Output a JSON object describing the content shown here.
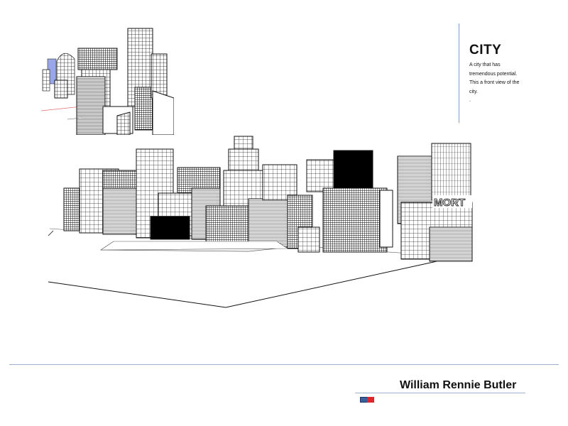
{
  "heading": "CITY",
  "description_lines": [
    "A city that has",
    "tremendous potential.",
    "This a front view of the",
    "city.",
    "."
  ],
  "sign_text": "MORT",
  "author": "William Rennie Butler",
  "logo_colors": {
    "left": "#3b5f9c",
    "right": "#e0252c"
  }
}
